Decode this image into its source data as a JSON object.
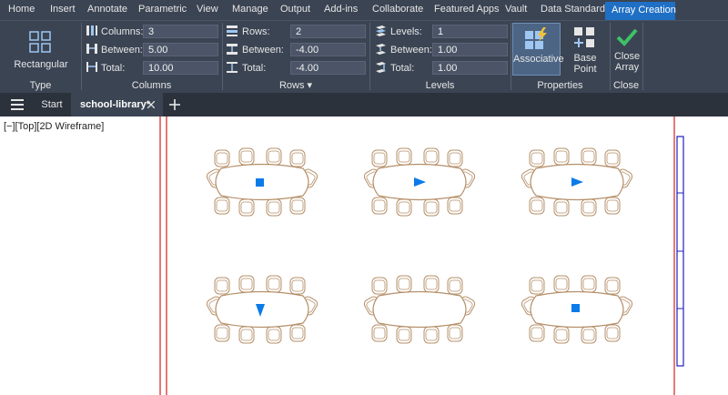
{
  "menu": {
    "tabs": [
      "Home",
      "Insert",
      "Annotate",
      "Parametric",
      "View",
      "Manage",
      "Output",
      "Add-ins",
      "Collaborate",
      "Featured Apps",
      "Vault",
      "Data Standard"
    ],
    "active_tab": "Array Creation"
  },
  "ribbon": {
    "type": {
      "button_label": "Rectangular",
      "panel_label": "Type"
    },
    "columns": {
      "panel_label": "Columns",
      "columns_label": "Columns:",
      "columns_value": "3",
      "between_label": "Between:",
      "between_value": "5.00",
      "total_label": "Total:",
      "total_value": "10.00"
    },
    "rows": {
      "panel_label": "Rows ▾",
      "rows_label": "Rows:",
      "rows_value": "2",
      "between_label": "Between:",
      "between_value": "-4.00",
      "total_label": "Total:",
      "total_value": "-4.00"
    },
    "levels": {
      "panel_label": "Levels",
      "levels_label": "Levels:",
      "levels_value": "1",
      "between_label": "Between:",
      "between_value": "1.00",
      "total_label": "Total:",
      "total_value": "1.00"
    },
    "properties": {
      "panel_label": "Properties",
      "associative_label": "Associative",
      "base_point_label": "Base Point"
    },
    "close": {
      "panel_label": "Close",
      "button_line1": "Close",
      "button_line2": "Array"
    }
  },
  "doc_tabs": {
    "start": "Start",
    "active_file": "school-library*"
  },
  "viewport": {
    "label": "[−][Top][2D Wireframe]"
  },
  "colors": {
    "furniture": "#b5906a",
    "grip": "#0a7be8",
    "accent": "#1f6fc5",
    "wall": "#d62020"
  }
}
